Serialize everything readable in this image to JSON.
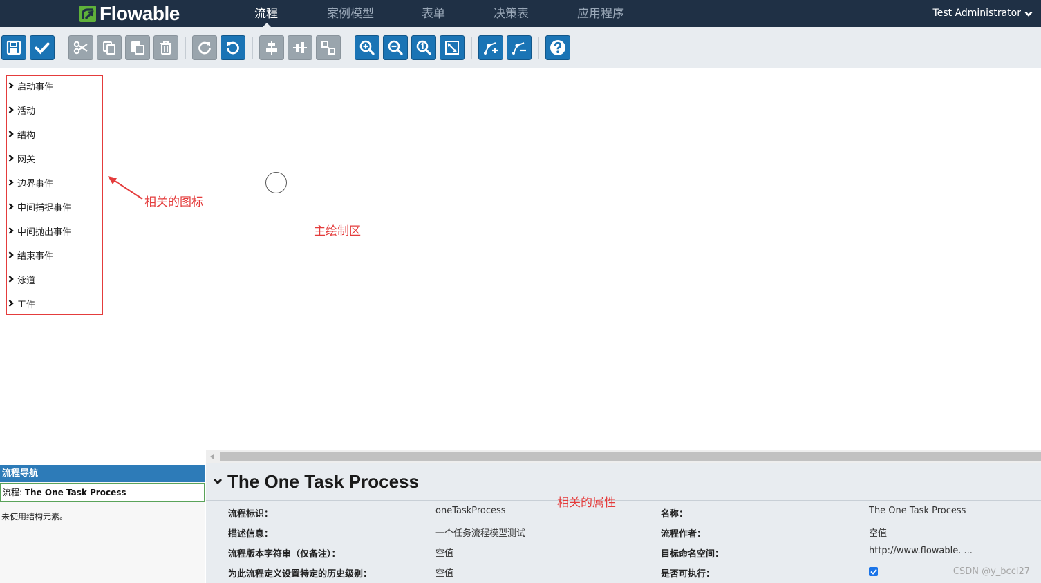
{
  "navbar": {
    "logo_text": "Flowable",
    "items": [
      {
        "label": "流程",
        "active": true
      },
      {
        "label": "案例模型",
        "active": false
      },
      {
        "label": "表单",
        "active": false
      },
      {
        "label": "决策表",
        "active": false
      },
      {
        "label": "应用程序",
        "active": false
      }
    ],
    "user": "Test Administrator"
  },
  "toolbar": {
    "buttons": [
      "save-icon",
      "check-icon",
      "cut-icon",
      "copy-icon",
      "paste-icon",
      "delete-icon",
      "redo-icon",
      "undo-icon",
      "align-horizontal-icon",
      "align-vertical-icon",
      "same-size-icon",
      "zoom-in-icon",
      "zoom-out-icon",
      "zoom-actual-icon",
      "zoom-fit-icon",
      "bendpoint-add-icon",
      "bendpoint-remove-icon",
      "help-icon"
    ]
  },
  "palette": {
    "items": [
      "启动事件",
      "活动",
      "结构",
      "网关",
      "边界事件",
      "中间捕捉事件",
      "中间抛出事件",
      "结束事件",
      "泳道",
      "工件"
    ]
  },
  "annotations": {
    "palette_note": "相关的图标",
    "canvas_note": "主绘制区",
    "props_note": "相关的属性"
  },
  "process_navigator": {
    "header": "流程导航",
    "row_prefix": "流程: ",
    "row_name": "The One Task Process",
    "empty_text": "未使用结构元素。"
  },
  "properties": {
    "title": "The One Task Process",
    "left": [
      {
        "label": "流程标识：",
        "value": "oneTaskProcess"
      },
      {
        "label": "描述信息：",
        "value": "一个任务流程模型测试"
      },
      {
        "label": "流程版本字符串（仅备注）：",
        "value": "空值"
      },
      {
        "label": "为此流程定义设置特定的历史级别：",
        "value": "空值"
      }
    ],
    "right": [
      {
        "label": "名称：",
        "value": "The One Task Process"
      },
      {
        "label": "流程作者：",
        "value": "空值"
      },
      {
        "label": "目标命名空间：",
        "value": "http://www.flowable. ..."
      },
      {
        "label": "是否可执行：",
        "value": "",
        "checked": true
      }
    ]
  },
  "watermark": "CSDN @y_bccl27",
  "colors": {
    "navbar_bg": "#1f3045",
    "toolbar_bg": "#e8ecf0",
    "button_blue": "#1a74b5",
    "button_gray": "#9aa5ad",
    "annotation_red": "#e43c3c",
    "navigator_header": "#2d7bb8",
    "logo_green": "#5fb13a"
  }
}
